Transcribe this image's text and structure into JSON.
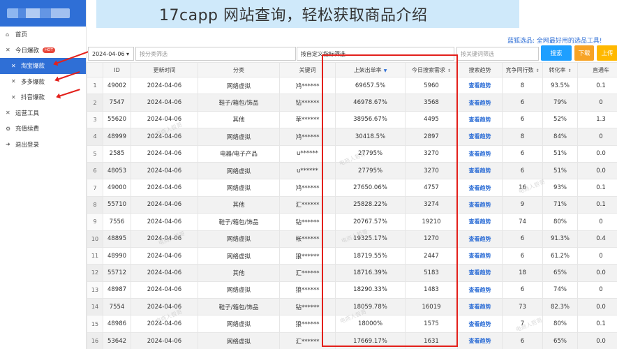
{
  "headline": "17capp 网站查询，轻松获取商品介绍",
  "promo": "蓝狐选品: 全网最好用的选品工具!",
  "sidebar": {
    "items": [
      {
        "icon": "home-icon",
        "glyph": "⌂",
        "label": "首页",
        "level": 0,
        "active": false
      },
      {
        "icon": "close-icon",
        "glyph": "✕",
        "label": "今日爆款",
        "badge": "HOT",
        "level": 0,
        "active": false
      },
      {
        "icon": "close-icon",
        "glyph": "✕",
        "label": "淘宝爆款",
        "level": 1,
        "active": true
      },
      {
        "icon": "close-icon",
        "glyph": "✕",
        "label": "多多爆款",
        "level": 1,
        "active": false
      },
      {
        "icon": "close-icon",
        "glyph": "✕",
        "label": "抖音爆款",
        "level": 1,
        "active": false
      },
      {
        "icon": "close-icon",
        "glyph": "✕",
        "label": "运营工具",
        "level": 0,
        "active": false
      },
      {
        "icon": "settings-icon",
        "glyph": "⚙",
        "label": "充值续费",
        "level": 0,
        "active": false
      },
      {
        "icon": "logout-icon",
        "glyph": "➜",
        "label": "退出登录",
        "level": 0,
        "active": false
      }
    ]
  },
  "toolbar": {
    "date": "2024-04-06 ▾",
    "category_placeholder": "按分类筛选",
    "metric_filter": "按自定义指标筛选",
    "keyword_placeholder": "按关键词筛选",
    "search_label": "搜索",
    "download_label": "下载",
    "upload_label": "上传"
  },
  "colors": {
    "primary": "#2f6fd6",
    "search": "#1e9fff",
    "download": "#f7a325",
    "upload": "#ffb800",
    "highlight_box": "#e3201b"
  },
  "table": {
    "headers": [
      "",
      "ID",
      "更新时间",
      "分类",
      "关键词",
      "上架出单率",
      "今日搜索需求",
      "搜索趋势",
      "竞争同行数",
      "转化率",
      "直通车"
    ],
    "trend_label": "查看趋势",
    "rows": [
      [
        "1",
        "49002",
        "2024-04-06",
        "网络虚拟",
        "鸿******",
        "69657.5%",
        "5960",
        "查看趋势",
        "8",
        "93.5%",
        "0.1"
      ],
      [
        "2",
        "7547",
        "2024-04-06",
        "鞋子/箱包/饰品",
        "钻******",
        "46978.67%",
        "3568",
        "查看趋势",
        "6",
        "79%",
        "0"
      ],
      [
        "3",
        "55620",
        "2024-04-06",
        "其他",
        "苹******",
        "38956.67%",
        "4495",
        "查看趋势",
        "6",
        "52%",
        "1.3"
      ],
      [
        "4",
        "48999",
        "2024-04-06",
        "网络虚拟",
        "鸿******",
        "30418.5%",
        "2897",
        "查看趋势",
        "8",
        "84%",
        "0"
      ],
      [
        "5",
        "2585",
        "2024-04-06",
        "电器/电子产品",
        "u******",
        "27795%",
        "3270",
        "查看趋势",
        "6",
        "51%",
        "0.0"
      ],
      [
        "6",
        "48053",
        "2024-04-06",
        "网络虚拟",
        "u******",
        "27795%",
        "3270",
        "查看趋势",
        "6",
        "51%",
        "0.0"
      ],
      [
        "7",
        "49000",
        "2024-04-06",
        "网络虚拟",
        "鸿******",
        "27650.06%",
        "4757",
        "查看趋势",
        "16",
        "93%",
        "0.1"
      ],
      [
        "8",
        "55710",
        "2024-04-06",
        "其他",
        "汇******",
        "25828.22%",
        "3274",
        "查看趋势",
        "9",
        "71%",
        "0.1"
      ],
      [
        "9",
        "7556",
        "2024-04-06",
        "鞋子/箱包/饰品",
        "钻******",
        "20767.57%",
        "19210",
        "查看趋势",
        "74",
        "80%",
        "0"
      ],
      [
        "10",
        "48895",
        "2024-04-06",
        "网络虚拟",
        "帐******",
        "19325.17%",
        "1270",
        "查看趋势",
        "6",
        "91.3%",
        "0.4"
      ],
      [
        "11",
        "48990",
        "2024-04-06",
        "网络虚拟",
        "狼******",
        "18719.55%",
        "2447",
        "查看趋势",
        "6",
        "61.2%",
        "0"
      ],
      [
        "12",
        "55712",
        "2024-04-06",
        "其他",
        "汇******",
        "18716.39%",
        "5183",
        "查看趋势",
        "18",
        "65%",
        "0.0"
      ],
      [
        "13",
        "48987",
        "2024-04-06",
        "网络虚拟",
        "狼******",
        "18290.33%",
        "1483",
        "查看趋势",
        "6",
        "74%",
        "0"
      ],
      [
        "14",
        "7554",
        "2024-04-06",
        "鞋子/箱包/饰品",
        "钻******",
        "18059.78%",
        "16019",
        "查看趋势",
        "73",
        "82.3%",
        "0.0"
      ],
      [
        "15",
        "48986",
        "2024-04-06",
        "网络虚拟",
        "狼******",
        "18000%",
        "1575",
        "查看趋势",
        "7",
        "80%",
        "0.1"
      ],
      [
        "16",
        "53642",
        "2024-04-06",
        "网络虚拟",
        "汇******",
        "17669.17%",
        "1631",
        "查看趋势",
        "6",
        "65%",
        "0.0"
      ]
    ]
  },
  "watermark": "电商人哲哥"
}
